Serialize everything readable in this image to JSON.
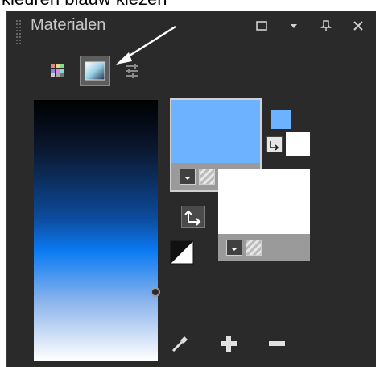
{
  "caption": {
    "text": "kleuren blauw kiezen"
  },
  "panel": {
    "title": "Materialen",
    "tools": [
      "maximize-icon",
      "dropdown-arrow-icon",
      "pin-icon",
      "close-icon"
    ]
  },
  "tabs": [
    {
      "name": "swatches-tab",
      "active": false
    },
    {
      "name": "gradient-tab",
      "active": true
    },
    {
      "name": "adjust-tab",
      "active": false
    }
  ],
  "colors": {
    "foreground": "#6cb2ff",
    "background": "#ffffff",
    "gradient_top": "#000000",
    "gradient_mid": "#0a7bf2",
    "gradient_bottom": "#ffffff",
    "panel_bg": "#2a2a2a"
  },
  "bottom_tools": [
    "eyedropper-icon",
    "plus-icon",
    "minus-icon"
  ]
}
